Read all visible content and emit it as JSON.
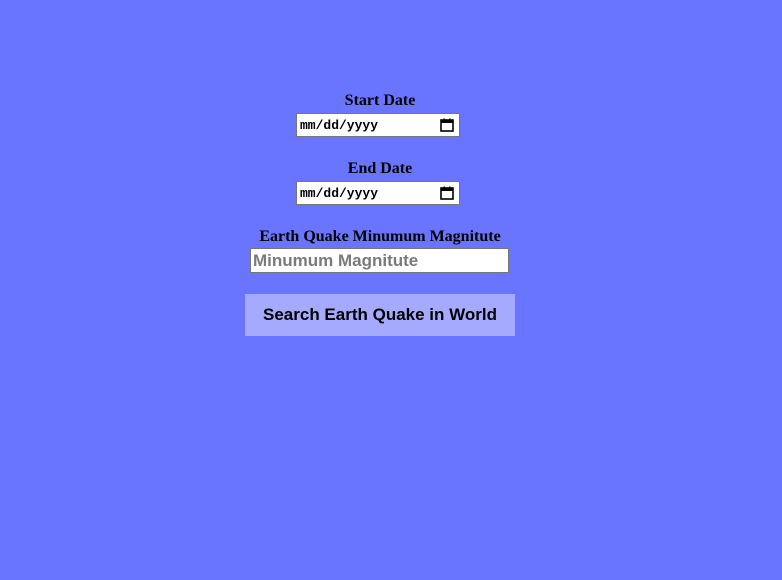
{
  "start_date": {
    "label": "Start Date",
    "value_display": "mm/dd/yyyy"
  },
  "end_date": {
    "label": "End Date",
    "value_display": "mm/dd/yyyy"
  },
  "magnitude": {
    "label": "Earth Quake Minumum Magnitute",
    "placeholder": "Minumum Magnitute",
    "value": ""
  },
  "search_button": {
    "label": "Search Earth Quake in World"
  },
  "colors": {
    "background": "#6a75ff",
    "button_background": "#a5aaff"
  },
  "icons": {
    "date_picker": "calendar-icon"
  }
}
